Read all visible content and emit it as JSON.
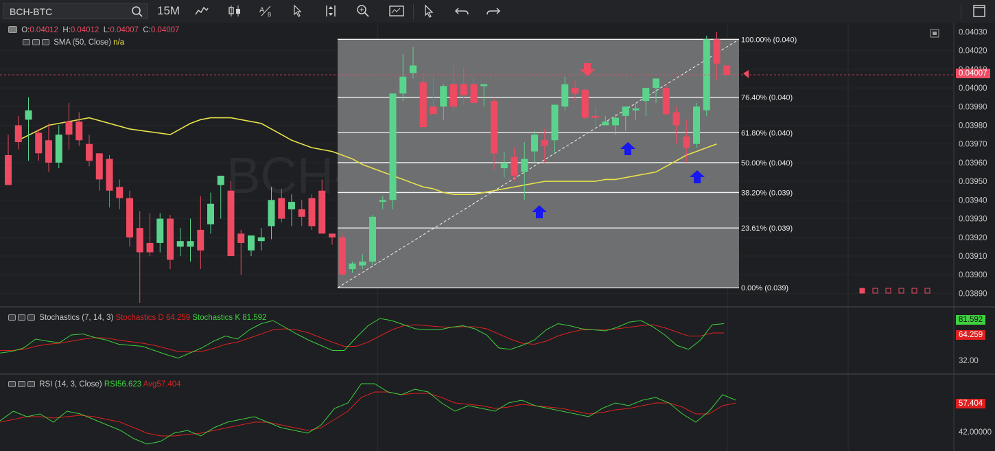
{
  "toolbar": {
    "symbol": "BCH-BTC",
    "interval": "15M",
    "icons": [
      "search-icon",
      "line-chart-icon",
      "candlestick-icon",
      "text-a-b-icon",
      "cursor-icon",
      "expand-vertical-icon",
      "zoom-in-icon",
      "chart-template-icon",
      "pointer-icon",
      "undo-icon",
      "redo-icon",
      "maximize-icon"
    ]
  },
  "legend": {
    "ohlc": {
      "o_label": "O:",
      "o": "0.04012",
      "h_label": "H:",
      "h": "0.04012",
      "l_label": "L:",
      "l": "0.04007",
      "c_label": "C:",
      "c": "0.04007"
    },
    "sma": {
      "label": "SMA (50, Close)",
      "value": "n/a"
    },
    "stoch": {
      "label": "Stochastics (7, 14, 3)",
      "d_label": "Stochastics D",
      "d": "64.259",
      "k_label": "Stochastics K",
      "k": "81.592"
    },
    "rsi": {
      "label": "RSI (14, 3, Close)",
      "rsi_label": "RSI",
      "rsi": "56.623",
      "avg_label": "Avg",
      "avg": "57.404"
    }
  },
  "watermark": "BCH-BTC, 15 Min",
  "price_axis": {
    "labels": [
      "0.04030",
      "0.04020",
      "0.04010",
      "0.04000",
      "0.03990",
      "0.03980",
      "0.03970",
      "0.03960",
      "0.03950",
      "0.03940",
      "0.03930",
      "0.03920",
      "0.03910",
      "0.03900",
      "0.03890"
    ],
    "current": "0.04007",
    "stoch_k": "81.592",
    "stoch_d": "64.259",
    "stoch_mid": "32.00",
    "rsi_avg": "57.404",
    "rsi_mid": "42.00000"
  },
  "fibonacci": [
    {
      "level": "100.00% (0.040)",
      "price": 0.04026
    },
    {
      "level": "76.40% (0.040)",
      "price": 0.03995
    },
    {
      "level": "61.80% (0.040)",
      "price": 0.03976
    },
    {
      "level": "50.00% (0.040)",
      "price": 0.0396
    },
    {
      "level": "38.20% (0.039)",
      "price": 0.03944
    },
    {
      "level": "23.61% (0.039)",
      "price": 0.03925
    },
    {
      "level": "0.00% (0.039)",
      "price": 0.03893
    }
  ],
  "colors": {
    "up": "#5ad48c",
    "down": "#ee4b63",
    "sma": "#e9e24a",
    "stoch_k": "#3fd13f",
    "stoch_d": "#e02020",
    "rsi": "#3fd13f",
    "rsi_avg": "#e02020",
    "arrow_up": "#1717f0",
    "arrow_down": "#ee4b63"
  },
  "chart_data": {
    "type": "candlestick",
    "ylim": [
      0.03885,
      0.04032
    ],
    "candles": [
      [
        0.03964,
        0.03975,
        0.03949,
        0.03948
      ],
      [
        0.0398,
        0.03985,
        0.03967,
        0.03971
      ],
      [
        0.03983,
        0.03995,
        0.03961,
        0.03988
      ],
      [
        0.03976,
        0.03978,
        0.03961,
        0.03965
      ],
      [
        0.03972,
        0.03981,
        0.03955,
        0.0396
      ],
      [
        0.0396,
        0.0398,
        0.03957,
        0.03975
      ],
      [
        0.03982,
        0.03992,
        0.03967,
        0.03975
      ],
      [
        0.03982,
        0.03987,
        0.03969,
        0.03972
      ],
      [
        0.0397,
        0.03975,
        0.03958,
        0.03961
      ],
      [
        0.03965,
        0.03965,
        0.03945,
        0.03951
      ],
      [
        0.03962,
        0.03964,
        0.03936,
        0.03945
      ],
      [
        0.03947,
        0.03951,
        0.03935,
        0.03941
      ],
      [
        0.03941,
        0.03945,
        0.03915,
        0.0392
      ],
      [
        0.03925,
        0.03934,
        0.03885,
        0.03912
      ],
      [
        0.03917,
        0.03933,
        0.0391,
        0.03912
      ],
      [
        0.03917,
        0.03933,
        0.03912,
        0.0393
      ],
      [
        0.0393,
        0.03932,
        0.03903,
        0.03908
      ],
      [
        0.03915,
        0.03925,
        0.0391,
        0.03918
      ],
      [
        0.03915,
        0.0393,
        0.03907,
        0.03918
      ],
      [
        0.03924,
        0.03942,
        0.03903,
        0.03913
      ],
      [
        0.03927,
        0.03944,
        0.03922,
        0.03938
      ],
      [
        0.03948,
        0.03952,
        0.0393,
        0.03953
      ],
      [
        0.03945,
        0.0395,
        0.0391,
        0.0391
      ],
      [
        0.03922,
        0.03924,
        0.039,
        0.03917
      ],
      [
        0.03913,
        0.0392,
        0.0391,
        0.03921
      ],
      [
        0.03918,
        0.03925,
        0.03913,
        0.0392
      ],
      [
        0.03926,
        0.03947,
        0.03919,
        0.0394
      ],
      [
        0.03941,
        0.03946,
        0.03928,
        0.0393
      ],
      [
        0.03935,
        0.03943,
        0.03926,
        0.03939
      ],
      [
        0.03935,
        0.0394,
        0.03926,
        0.03931
      ],
      [
        0.03941,
        0.03943,
        0.03924,
        0.03926
      ],
      [
        0.03945,
        0.03951,
        0.03924,
        0.03922
      ],
      [
        0.03922,
        0.03922,
        0.03916,
        0.0392
      ],
      [
        0.0392,
        0.03922,
        0.0391,
        0.039
      ],
      [
        0.03903,
        0.03907,
        0.03901,
        0.03906
      ],
      [
        0.03905,
        0.03911,
        0.03903,
        0.03907
      ],
      [
        0.03907,
        0.03932,
        0.03905,
        0.03931
      ],
      [
        0.03939,
        0.03942,
        0.03935,
        0.0394
      ],
      [
        0.0394,
        0.0399,
        0.03935,
        0.03997
      ],
      [
        0.03997,
        0.04018,
        0.03993,
        0.04006
      ],
      [
        0.04008,
        0.04022,
        0.04005,
        0.04012
      ],
      [
        0.04003,
        0.04008,
        0.0398,
        0.03979
      ],
      [
        0.0399,
        0.04006,
        0.03986,
        0.03986
      ],
      [
        0.0399,
        0.04002,
        0.03983,
        0.04001
      ],
      [
        0.04002,
        0.04012,
        0.03988,
        0.0399
      ],
      [
        0.04002,
        0.04011,
        0.03991,
        0.03996
      ],
      [
        0.04002,
        0.04006,
        0.03991,
        0.03992
      ],
      [
        0.04001,
        0.04001,
        0.0399,
        0.04002
      ],
      [
        0.03993,
        0.03995,
        0.03956,
        0.03965
      ],
      [
        0.03957,
        0.03966,
        0.03952,
        0.0396
      ],
      [
        0.03963,
        0.03968,
        0.0395,
        0.03953
      ],
      [
        0.03955,
        0.03971,
        0.0394,
        0.03962
      ],
      [
        0.03966,
        0.03977,
        0.0396,
        0.03975
      ],
      [
        0.03972,
        0.03978,
        0.0396,
        0.03969
      ],
      [
        0.03972,
        0.0399,
        0.03965,
        0.03991
      ],
      [
        0.0399,
        0.04006,
        0.03988,
        0.04002
      ],
      [
        0.04,
        0.04004,
        0.03993,
        0.03997
      ],
      [
        0.03999,
        0.04,
        0.03983,
        0.03984
      ],
      [
        0.03985,
        0.0399,
        0.0398,
        0.03984
      ],
      [
        0.0398,
        0.03985,
        0.0398,
        0.03982
      ],
      [
        0.0398,
        0.03986,
        0.03975,
        0.03984
      ],
      [
        0.03985,
        0.0399,
        0.03977,
        0.0399
      ],
      [
        0.03988,
        0.03992,
        0.03983,
        0.03989
      ],
      [
        0.03993,
        0.04,
        0.03985,
        0.04
      ],
      [
        0.04,
        0.04005,
        0.03992,
        0.04005
      ],
      [
        0.04,
        0.04002,
        0.03985,
        0.03986
      ],
      [
        0.03987,
        0.0399,
        0.0397,
        0.0398
      ],
      [
        0.03974,
        0.03983,
        0.0396,
        0.03968
      ],
      [
        0.0397,
        0.03992,
        0.03968,
        0.0399
      ],
      [
        0.03988,
        0.04028,
        0.03985,
        0.04026
      ],
      [
        0.04026,
        0.0403,
        0.04004,
        0.04013
      ],
      [
        0.04012,
        0.04012,
        0.04007,
        0.04007
      ]
    ],
    "sma": [
      0.03975,
      0.03978,
      0.03981,
      0.03983,
      0.03984,
      0.03984,
      0.03984,
      0.03983,
      0.03982,
      0.03981,
      0.03978,
      0.03975,
      0.03972,
      0.0397,
      0.03968,
      0.03967,
      0.03966,
      0.03964,
      0.03962,
      0.03959,
      0.03957,
      0.03955,
      0.03953,
      0.03951,
      0.03949,
      0.03947,
      0.03946,
      0.03944,
      0.03943,
      0.03943,
      0.03943,
      0.03944,
      0.03945,
      0.03946,
      0.03947,
      0.03948,
      0.03949,
      0.0395,
      0.0395,
      0.0395,
      0.0395,
      0.0395,
      0.0395,
      0.03951,
      0.03951,
      0.03952,
      0.03953,
      0.03954,
      0.03955,
      0.03958,
      0.03961,
      0.03964,
      0.03966,
      0.03968,
      0.0397
    ]
  }
}
